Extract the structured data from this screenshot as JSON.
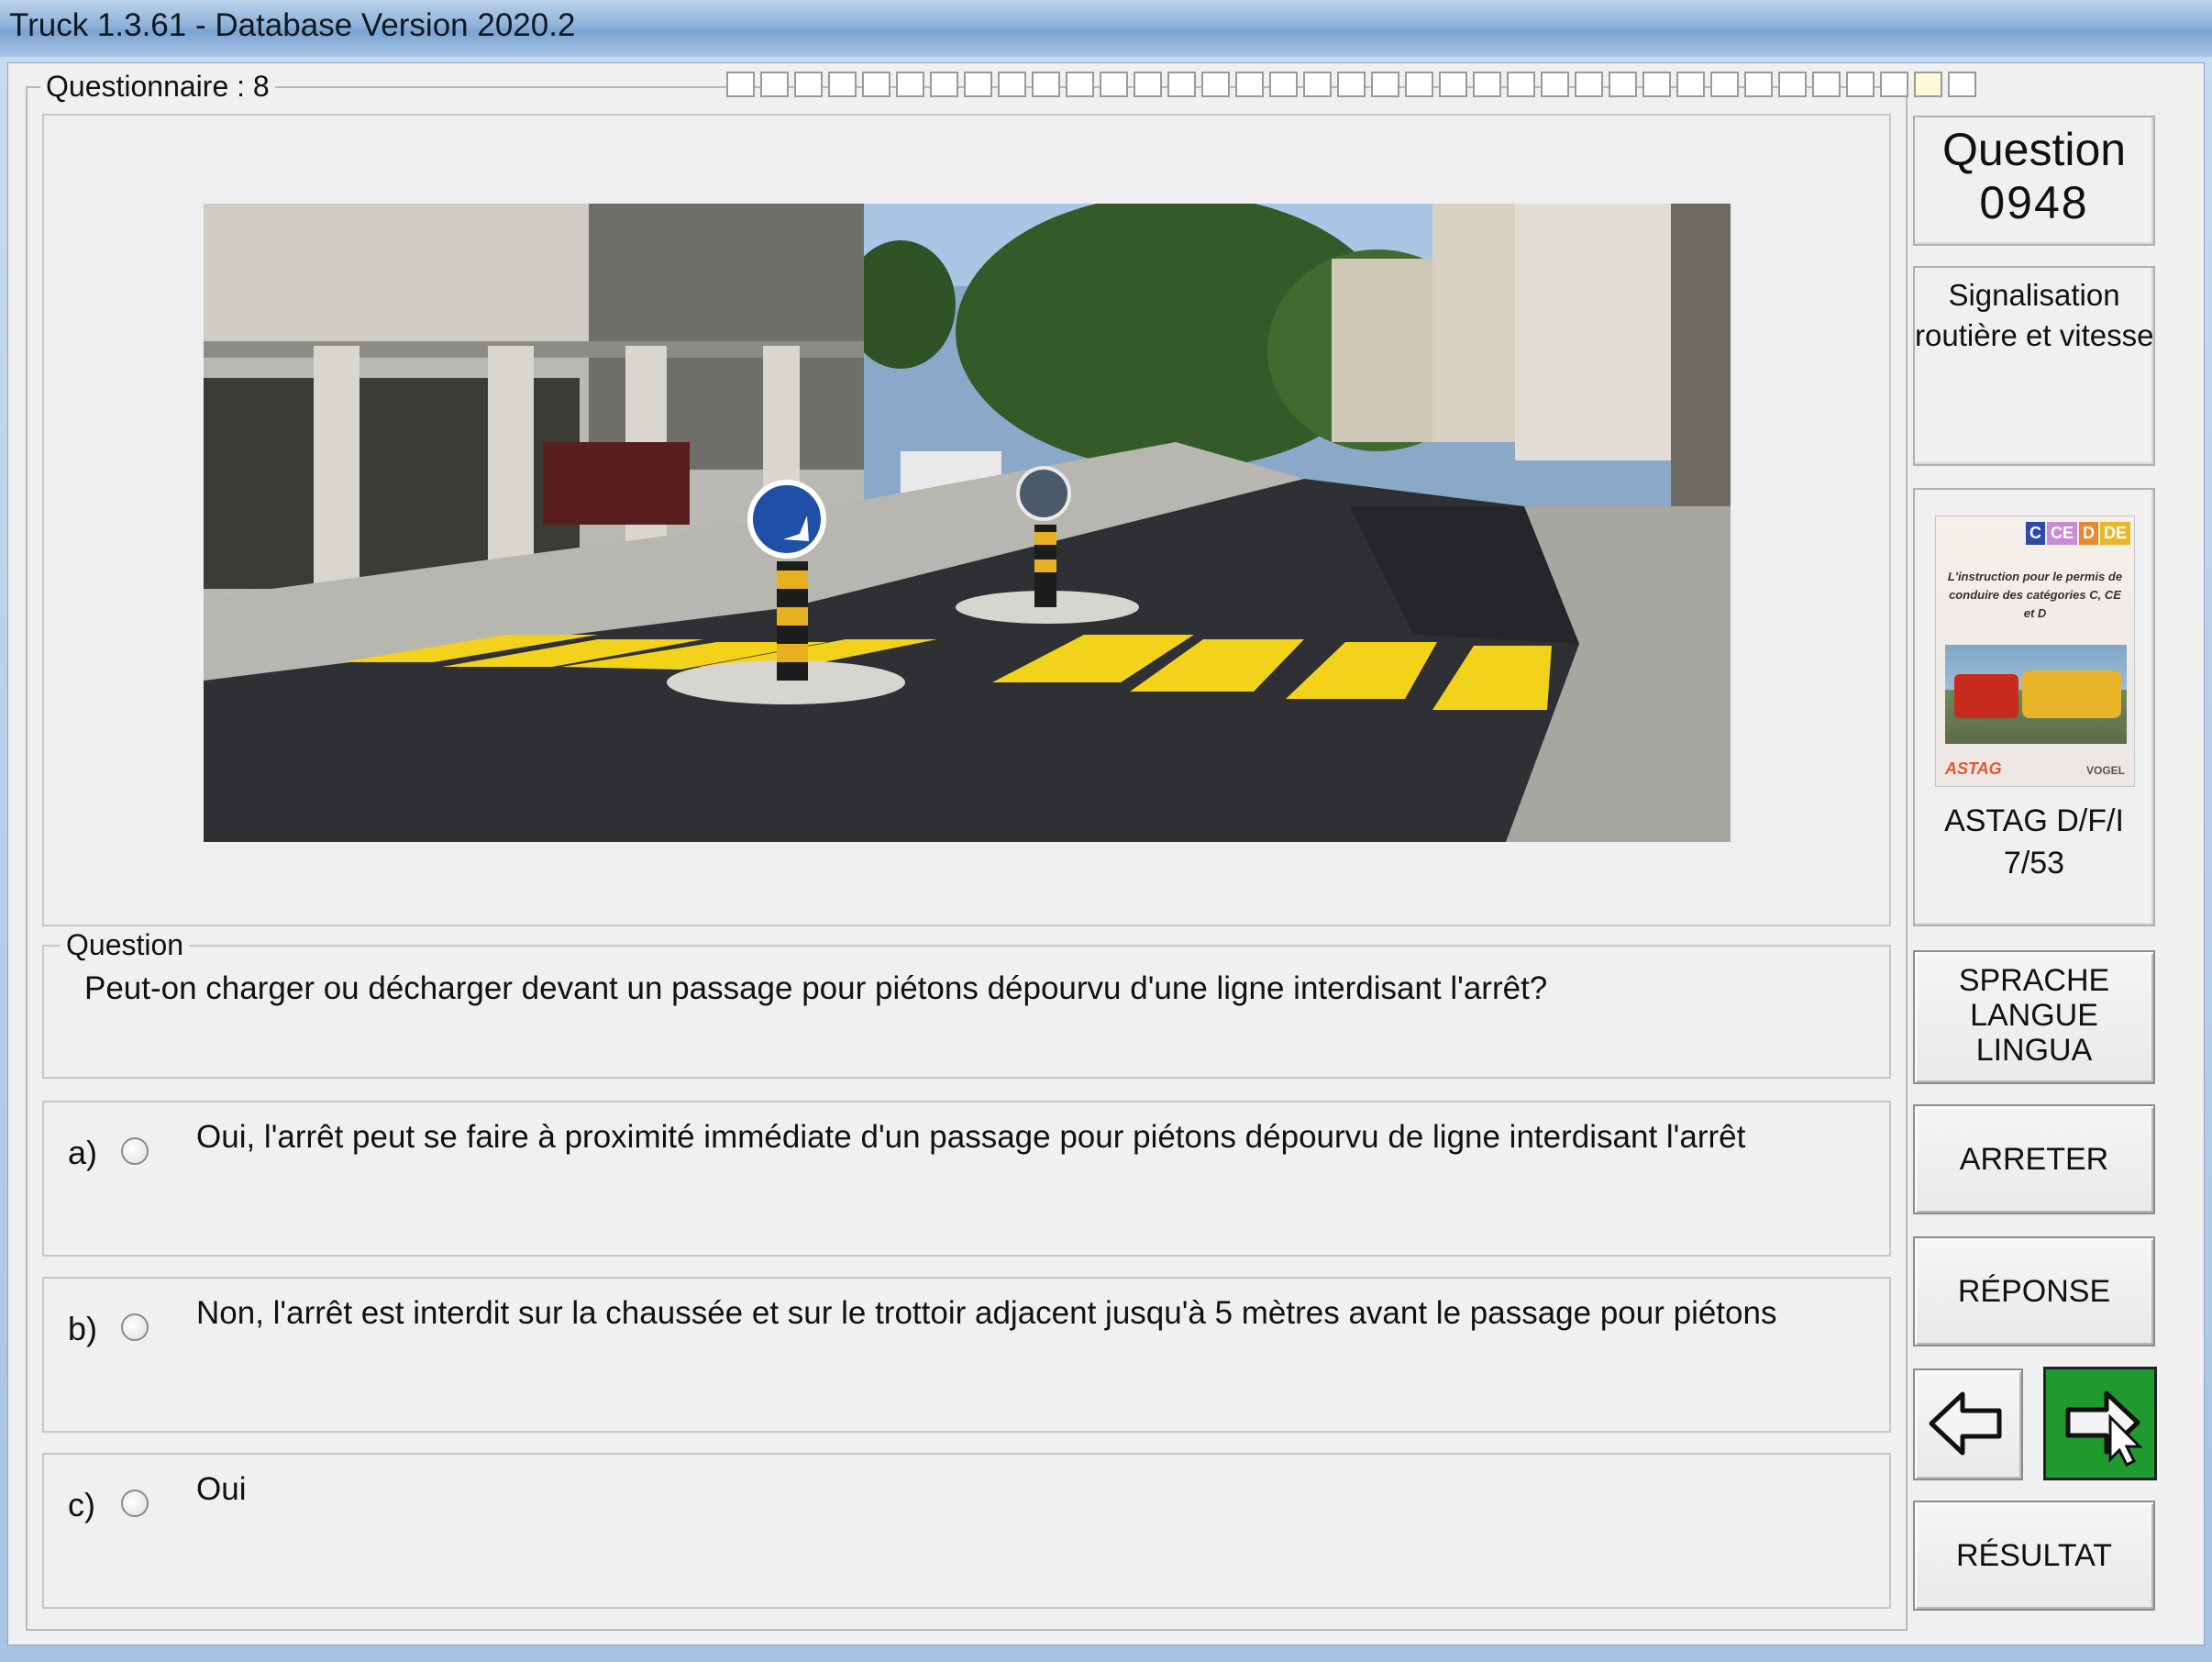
{
  "window": {
    "title": "Truck 1.3.61 - Database Version 2020.2"
  },
  "questionnaire": {
    "label": "Questionnaire : 8",
    "total_cells": 37,
    "current_cell": 36
  },
  "question": {
    "header_line1": "Question",
    "number": "0948",
    "category_line1": "Signalisation",
    "category_line2": "routière et vitesse",
    "group_label": "Question",
    "text": "Peut-on charger ou décharger devant un passage pour piétons dépourvu d'une ligne interdisant l'arrêt?"
  },
  "answers": [
    {
      "letter": "a)",
      "text": "Oui, l'arrêt peut se faire à proximité immédiate d'un passage pour piétons dépourvu de ligne interdisant l'arrêt",
      "selected": false
    },
    {
      "letter": "b)",
      "text": "Non, l'arrêt est interdit sur la chaussée et sur le trottoir adjacent jusqu'à 5 mètres avant le passage pour piétons",
      "selected": false
    },
    {
      "letter": "c)",
      "text": "Oui",
      "selected": false
    }
  ],
  "reference": {
    "book_badges": [
      "C",
      "CE",
      "D",
      "DE"
    ],
    "book_title": "L'instruction pour le permis de conduire des catégories C, CE et D",
    "book_logo_left": "ASTAG",
    "book_logo_right": "VOGEL",
    "source_line1": "ASTAG D/F/I",
    "source_line2": "7/53"
  },
  "buttons": {
    "language_line1": "SPRACHE",
    "language_line2": "LANGUE",
    "language_line3": "LINGUA",
    "stop": "ARRETER",
    "answer": "RÉPONSE",
    "result": "RÉSULTAT"
  },
  "colors": {
    "next_button": "#1f9a2e",
    "crosswalk": "#f3d21c"
  }
}
